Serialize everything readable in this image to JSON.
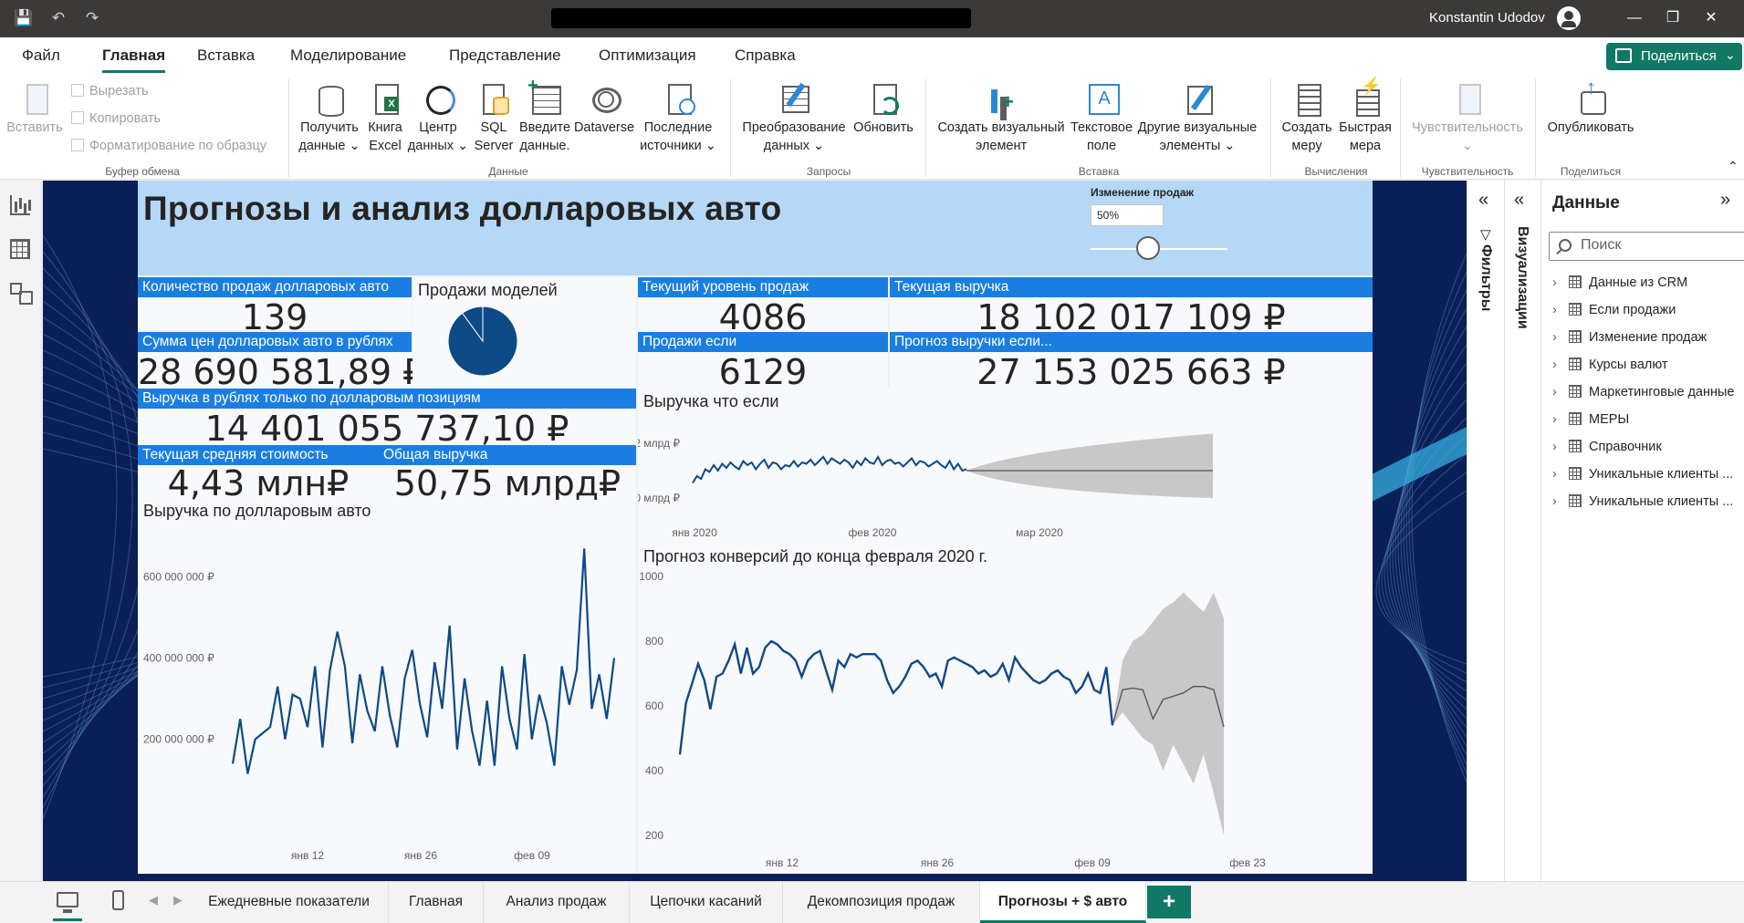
{
  "user": {
    "name": "Konstantin Udodov"
  },
  "titlebar": {
    "save_icon": "save-icon",
    "undo_icon": "undo-icon",
    "redo_icon": "redo-icon"
  },
  "ribbon_tabs": [
    "Файл",
    "Главная",
    "Вставка",
    "Моделирование",
    "Представление",
    "Оптимизация",
    "Справка"
  ],
  "share_label": "Поделиться",
  "ribbon": {
    "clipboard": {
      "paste": "Вставить",
      "cut": "Вырезать",
      "copy": "Копировать",
      "format": "Форматирование по образцу",
      "group": "Буфер обмена"
    },
    "data": {
      "get_data_1": "Получить",
      "get_data_2": "данные",
      "excel_1": "Книга",
      "excel_2": "Excel",
      "hub_1": "Центр",
      "hub_2": "данных",
      "sql_1": "SQL",
      "sql_2": "Server",
      "enter_1": "Введите",
      "enter_2": "данные.",
      "dataverse": "Dataverse",
      "recent_1": "Последние",
      "recent_2": "источники",
      "group": "Данные"
    },
    "queries": {
      "transform_1": "Преобразование",
      "transform_2": "данных",
      "refresh": "Обновить",
      "group": "Запросы"
    },
    "insert": {
      "visual_1": "Создать визуальный",
      "visual_2": "элемент",
      "text_1": "Текстовое",
      "text_2": "поле",
      "more_1": "Другие визуальные",
      "more_2": "элементы",
      "group": "Вставка"
    },
    "calc": {
      "measure_1": "Создать",
      "measure_2": "меру",
      "quick_1": "Быстрая",
      "quick_2": "мера",
      "group": "Вычисления"
    },
    "sensitivity": {
      "label": "Чувствительность",
      "group": "Чувствительность"
    },
    "share": {
      "publish": "Опубликовать",
      "group": "Поделиться"
    }
  },
  "report": {
    "title": "Прогнозы и анализ долларовых авто",
    "slicer": {
      "title": "Изменение продаж",
      "value": "50%",
      "level": 0.5
    },
    "cards": {
      "count": {
        "title": "Количество продаж долларовых авто",
        "value": "139"
      },
      "sum": {
        "title": "Сумма цен долларовых авто в рублях",
        "value": "28 690 581,89 ₽"
      },
      "revenue_usd": {
        "title": "Выручка в рублях только по долларовым позициям",
        "value": "14 401 055 737,10 ₽"
      },
      "avg": {
        "title": "Текущая средняя стоимость",
        "value": "4,43 млн₽"
      },
      "total": {
        "title": "Общая выручка",
        "value": "50,75 млрд₽"
      },
      "sales_level": {
        "title": "Текущий уровень продаж",
        "value": "4086"
      },
      "revenue_current": {
        "title": "Текущая выручка",
        "value": "18 102 017 109 ₽"
      },
      "sales_if": {
        "title": "Продажи если",
        "value": "6129"
      },
      "revenue_forecast": {
        "title": "Прогноз выручки если...",
        "value": "27 153 025 663 ₽"
      }
    },
    "pie_title": "Продажи моделей",
    "whatif_title": "Выручка что если",
    "dollar_title": "Выручка по долларовым авто",
    "conv_title": "Прогноз конверсий до конца февраля 2020 г."
  },
  "colors": {
    "accent": "#117865",
    "card_header": "#1a7ee0",
    "series": "#0d4a86",
    "forecast_band": "#c8c8c8",
    "bg": "#0b1f57",
    "header_band": "#b6d8f7"
  },
  "chart_data": [
    {
      "type": "pie",
      "title": "Продажи моделей",
      "values": [
        0.9,
        0.1
      ]
    },
    {
      "type": "line",
      "title": "Выручка что если",
      "y_ticks": [
        "2 млрд ₽",
        "0 млрд ₽"
      ],
      "x_ticks": [
        "янв 2020",
        "фев 2020",
        "мар 2020"
      ],
      "ylim": [
        0,
        2
      ],
      "values_mlrd": [
        0.55,
        0.8,
        0.7,
        1.05,
        0.95,
        1.2,
        1.0,
        1.25,
        1.1,
        1.3,
        1.15,
        1.05,
        1.35,
        1.2,
        1.3,
        1.05,
        1.25,
        1.4,
        1.1,
        1.3,
        1.25,
        1.05,
        1.2,
        1.15,
        1.35,
        1.15,
        1.3,
        1.25,
        1.4,
        1.2,
        1.35,
        1.5,
        1.25,
        1.45,
        1.35,
        1.25,
        1.4,
        1.3,
        1.1,
        1.35,
        1.2,
        1.45,
        1.3,
        1.25,
        1.5,
        1.2,
        1.35,
        1.4,
        1.25,
        1.3,
        1.15,
        1.3,
        1.45,
        1.2,
        1.35,
        1.3,
        1.15,
        1.25,
        1.35,
        1.2,
        1.1,
        1.35,
        1.05,
        1.25,
        1.0,
        1.05
      ],
      "forecast_mid": 1.0,
      "forecast_lower_end": 0.0,
      "forecast_upper_end": 2.35,
      "forecast_points": 58
    },
    {
      "type": "line",
      "title": "Выручка по долларовым авто",
      "y_ticks": [
        "600 000 000 ₽",
        "400 000 000 ₽",
        "200 000 000 ₽"
      ],
      "x_ticks": [
        "янв 12",
        "янв 26",
        "фев 09"
      ],
      "ylim": [
        80000000,
        700000000
      ],
      "values": [
        140000000,
        250000000,
        115000000,
        200000000,
        215000000,
        230000000,
        330000000,
        200000000,
        310000000,
        300000000,
        230000000,
        380000000,
        180000000,
        370000000,
        465000000,
        380000000,
        190000000,
        360000000,
        270000000,
        220000000,
        380000000,
        260000000,
        180000000,
        350000000,
        420000000,
        290000000,
        205000000,
        390000000,
        275000000,
        480000000,
        175000000,
        350000000,
        220000000,
        135000000,
        295000000,
        135000000,
        380000000,
        250000000,
        175000000,
        410000000,
        200000000,
        310000000,
        240000000,
        135000000,
        380000000,
        285000000,
        370000000,
        670000000,
        275000000,
        360000000,
        250000000,
        400000000
      ]
    },
    {
      "type": "line",
      "title": "Прогноз конверсий до конца февраля 2020 г.",
      "y_ticks": [
        "1000",
        "800",
        "600",
        "400",
        "200"
      ],
      "x_ticks": [
        "янв 12",
        "янв 26",
        "фев 09",
        "фев 23"
      ],
      "ylim": [
        200,
        1000
      ],
      "values": [
        450,
        610,
        670,
        730,
        680,
        590,
        690,
        700,
        740,
        790,
        700,
        780,
        700,
        720,
        780,
        800,
        790,
        770,
        760,
        740,
        690,
        740,
        760,
        770,
        710,
        650,
        740,
        720,
        760,
        750,
        760,
        760,
        760,
        740,
        680,
        640,
        660,
        690,
        730,
        740,
        720,
        690,
        700,
        660,
        740,
        750,
        740,
        730,
        720,
        700,
        710,
        690,
        700,
        730,
        680,
        750,
        720,
        700,
        680,
        670,
        680,
        700,
        710,
        690,
        680,
        640,
        660,
        700,
        650,
        640,
        720,
        540
      ],
      "forecast_values": [
        540,
        650,
        655,
        650,
        560,
        620,
        630,
        640,
        660,
        660,
        650,
        535
      ],
      "forecast_upper": [
        540,
        740,
        800,
        820,
        860,
        900,
        920,
        950,
        920,
        890,
        950,
        870
      ],
      "forecast_lower": [
        540,
        580,
        540,
        500,
        480,
        400,
        480,
        420,
        360,
        450,
        330,
        200
      ]
    }
  ],
  "fields_pane": {
    "title": "Данные",
    "search_placeholder": "Поиск",
    "filters_label": "Фильтры",
    "viz_label": "Визуализации",
    "items": [
      "Данные из CRM",
      "Если продажи",
      "Изменение продаж",
      "Курсы валют",
      "Маркетинговые данные",
      "МЕРЫ",
      "Справочник",
      "Уникальные клиенты ...",
      "Уникальные клиенты ..."
    ]
  },
  "page_tabs": [
    "Ежедневные показатели",
    "Главная",
    "Анализ продаж",
    "Цепочки касаний",
    "Декомпозиция продаж",
    "Прогнозы + $ авто"
  ],
  "active_page": "Прогнозы + $ авто"
}
